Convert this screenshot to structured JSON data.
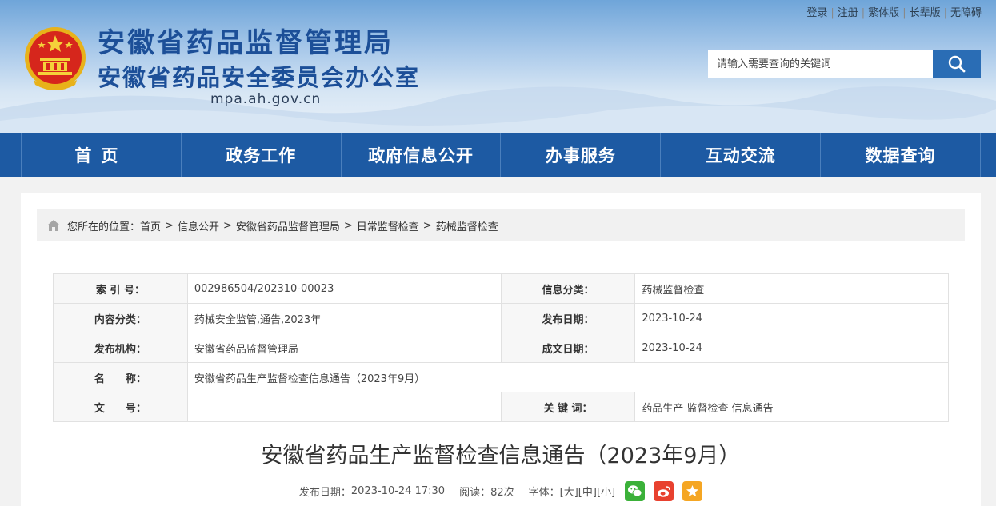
{
  "header": {
    "title_line1": "安徽省药品监督管理局",
    "title_line2": "安徽省药品安全委员会办公室",
    "domain": "mpa.ah.gov.cn",
    "top_links": [
      "登录",
      "注册",
      "繁体版",
      "长辈版",
      "无障碍"
    ],
    "search": {
      "placeholder": "请输入需要查询的关键词",
      "icon": "search-icon"
    },
    "brand_color": "#1c4f98"
  },
  "nav": {
    "items": [
      "首页",
      "政务工作",
      "政府信息公开",
      "办事服务",
      "互动交流",
      "数据查询"
    ],
    "bg_color": "#1d5aa3"
  },
  "breadcrumb": {
    "prefix": "您所在的位置：",
    "items": [
      "首页",
      "信息公开",
      "安徽省药品监督管理局",
      "日常监督检查",
      "药械监督检查"
    ],
    "separator": ">",
    "icon": "home-icon"
  },
  "meta": {
    "index_label": "索 引 号：",
    "index_value": "002986504/202310-00023",
    "category_label": "信息分类：",
    "category_value": "药械监督检查",
    "content_type_label": "内容分类：",
    "content_type_value": "药械安全监管,通告,2023年",
    "publish_date_label": "发布日期：",
    "publish_date_value": "2023-10-24",
    "publisher_label": "发布机构：",
    "publisher_value": "安徽省药品监督管理局",
    "created_date_label": "成文日期：",
    "created_date_value": "2023-10-24",
    "name_label": "名　　称：",
    "name_value": "安徽省药品生产监督检查信息通告（2023年9月）",
    "doc_no_label": "文　　号：",
    "doc_no_value": "",
    "keywords_label": "关 键 词：",
    "keywords_value": "药品生产 监督检查 信息通告"
  },
  "article": {
    "title": "安徽省药品生产监督检查信息通告（2023年9月）",
    "publish_label": "发布日期：",
    "publish_value": "2023-10-24 17:30",
    "reads_label": "阅读：",
    "reads_value": "82次",
    "font_label": "字体：",
    "font_large": "[大]",
    "font_medium": "[中]",
    "font_small": "[小]",
    "share_icons": [
      {
        "name": "wechat-icon",
        "color": "#3bb139"
      },
      {
        "name": "weibo-icon",
        "color": "#e8412f"
      },
      {
        "name": "favorite-icon",
        "color": "#f5a623"
      }
    ]
  }
}
